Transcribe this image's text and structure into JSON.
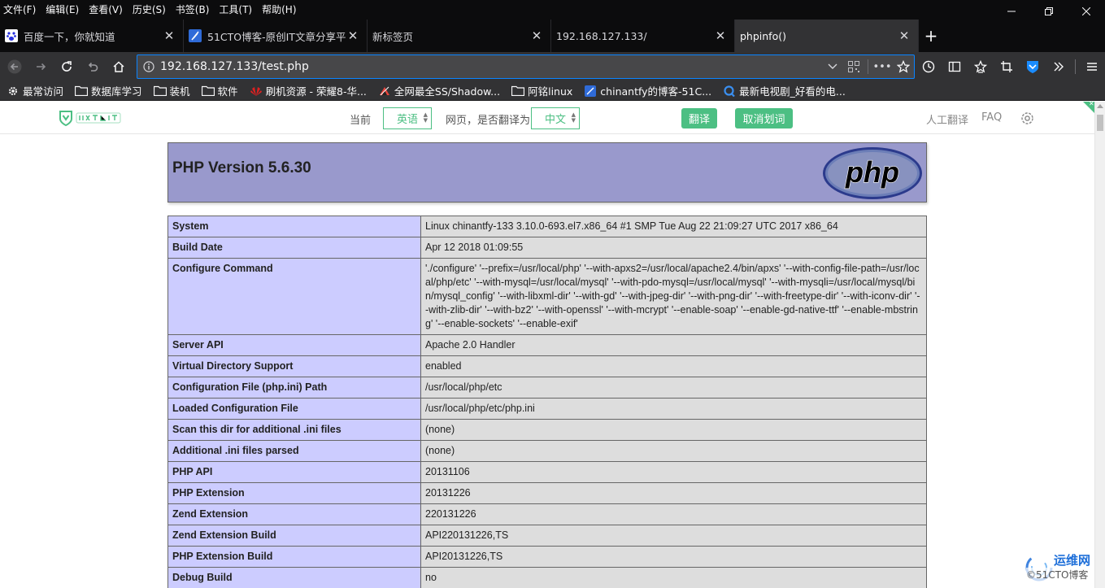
{
  "menubar": {
    "items": [
      "文件(F)",
      "编辑(E)",
      "查看(V)",
      "历史(S)",
      "书签(B)",
      "工具(T)",
      "帮助(H)"
    ]
  },
  "tabs": [
    {
      "title": "百度一下，你就知道",
      "icon": "baidu-paw-icon",
      "active": false
    },
    {
      "title": "51CTO博客-原创IT文章分享平",
      "icon": "feather-icon",
      "active": false
    },
    {
      "title": "新标签页",
      "icon": "",
      "active": false
    },
    {
      "title": "192.168.127.133/",
      "icon": "",
      "active": false
    },
    {
      "title": "phpinfo()",
      "icon": "",
      "active": true
    }
  ],
  "navbar": {
    "url": "192.168.127.133/test.php"
  },
  "bookmarks": [
    {
      "label": "最常访问",
      "icon": "gear-icon"
    },
    {
      "label": "数据库学习",
      "icon": "folder-icon"
    },
    {
      "label": "装机",
      "icon": "folder-icon"
    },
    {
      "label": "软件",
      "icon": "folder-icon"
    },
    {
      "label": "刷机资源 - 荣耀8-华...",
      "icon": "huawei-icon"
    },
    {
      "label": "全网最全SS/Shadow...",
      "icon": "colorful-icon"
    },
    {
      "label": "阿铭linux",
      "icon": "folder-icon"
    },
    {
      "label": "chinantfy的博客-51C...",
      "icon": "feather-icon"
    },
    {
      "label": "最新电视剧_好看的电...",
      "icon": "q-icon"
    }
  ],
  "translate_bar": {
    "current_label": "当前",
    "source_lang": "英语",
    "question_label": "网页，是否翻译为",
    "target_lang": "中文",
    "translate_button": "翻译",
    "cancel_button": "取消划词",
    "human_translate": "人工翻译",
    "faq": "FAQ",
    "brand_color": "#4cbf83"
  },
  "php": {
    "title": "PHP Version 5.6.30",
    "logo_text": "php",
    "rows": [
      {
        "key": "System",
        "value": "Linux chinantfy-133 3.10.0-693.el7.x86_64 #1 SMP Tue Aug 22 21:09:27 UTC 2017 x86_64"
      },
      {
        "key": "Build Date",
        "value": "Apr 12 2018 01:09:55"
      },
      {
        "key": "Configure Command",
        "value": "'./configure' '--prefix=/usr/local/php' '--with-apxs2=/usr/local/apache2.4/bin/apxs' '--with-config-file-path=/usr/local/php/etc' '--with-mysql=/usr/local/mysql' '--with-pdo-mysql=/usr/local/mysql' '--with-mysqli=/usr/local/mysql/bin/mysql_config' '--with-libxml-dir' '--with-gd' '--with-jpeg-dir' '--with-png-dir' '--with-freetype-dir' '--with-iconv-dir' '--with-zlib-dir' '--with-bz2' '--with-openssl' '--with-mcrypt' '--enable-soap' '--enable-gd-native-ttf' '--enable-mbstring' '--enable-sockets' '--enable-exif'"
      },
      {
        "key": "Server API",
        "value": "Apache 2.0 Handler"
      },
      {
        "key": "Virtual Directory Support",
        "value": "enabled"
      },
      {
        "key": "Configuration File (php.ini) Path",
        "value": "/usr/local/php/etc"
      },
      {
        "key": "Loaded Configuration File",
        "value": "/usr/local/php/etc/php.ini"
      },
      {
        "key": "Scan this dir for additional .ini files",
        "value": "(none)"
      },
      {
        "key": "Additional .ini files parsed",
        "value": "(none)"
      },
      {
        "key": "PHP API",
        "value": "20131106"
      },
      {
        "key": "PHP Extension",
        "value": "20131226"
      },
      {
        "key": "Zend Extension",
        "value": "220131226"
      },
      {
        "key": "Zend Extension Build",
        "value": "API220131226,TS"
      },
      {
        "key": "PHP Extension Build",
        "value": "API20131226,TS"
      },
      {
        "key": "Debug Build",
        "value": "no"
      }
    ]
  },
  "watermark": {
    "main": "运维网",
    "sub": "©51CTO博客"
  }
}
